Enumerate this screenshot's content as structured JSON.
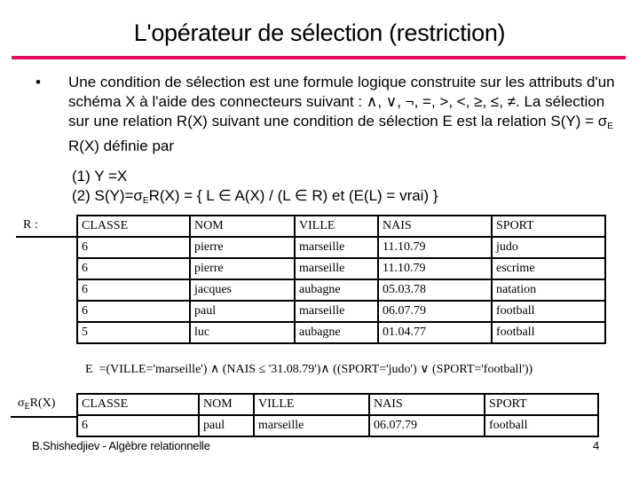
{
  "title": "L'opérateur de sélection (restriction)",
  "accent_color": "#e0105f",
  "bullet": {
    "marker": "•",
    "text_part1": "Une condition de sélection est une formule logique construite sur les attributs d'un schéma X à l'aide des connecteurs suivant : ∧, ∨, ¬, =, >, <, ≥, ≤, ≠.  La sélection sur une relation R(X) suivant une condition de sélection E est la relation S(Y) = σ",
    "text_sub": "E",
    "text_part2": " R(X) définie par",
    "line1": "(1) Y =X",
    "line2_a": "(2) S(Y)=σ",
    "line2_sub": "E",
    "line2_b": "R(X)  = { L ∈ A(X) /  (L ∈ R) et (E(L) = vrai) }"
  },
  "relation_r": {
    "label": "R :",
    "headers": [
      "CLASSE",
      "NOM",
      "VILLE",
      "NAIS",
      "SPORT"
    ],
    "rows": [
      [
        "6",
        "pierre",
        "marseille",
        "11.10.79",
        "judo"
      ],
      [
        "6",
        "pierre",
        "marseille",
        "11.10.79",
        "escrime"
      ],
      [
        "6",
        "jacques",
        "aubagne",
        "05.03.78",
        "natation"
      ],
      [
        "6",
        "paul",
        "marseille",
        "06.07.79",
        "football"
      ],
      [
        "5",
        "luc",
        "aubagne",
        "01.04.77",
        "football"
      ]
    ]
  },
  "condition": {
    "label": "E",
    "formula": "=(VILLE='marseille') ∧ (NAIS ≤ '31.08.79')∧ ((SPORT='judo') ∨ (SPORT='football'))"
  },
  "relation_result": {
    "label_a": "σ",
    "label_sub": "E",
    "label_b": "R(X)",
    "headers": [
      "CLASSE",
      "NOM",
      "VILLE",
      "NAIS",
      "SPORT"
    ],
    "rows": [
      [
        "6",
        "paul",
        "marseille",
        "06.07.79",
        "football"
      ]
    ]
  },
  "footer": {
    "author": "B.Shishedjiev - Algèbre relationnelle",
    "page_number": "4"
  }
}
